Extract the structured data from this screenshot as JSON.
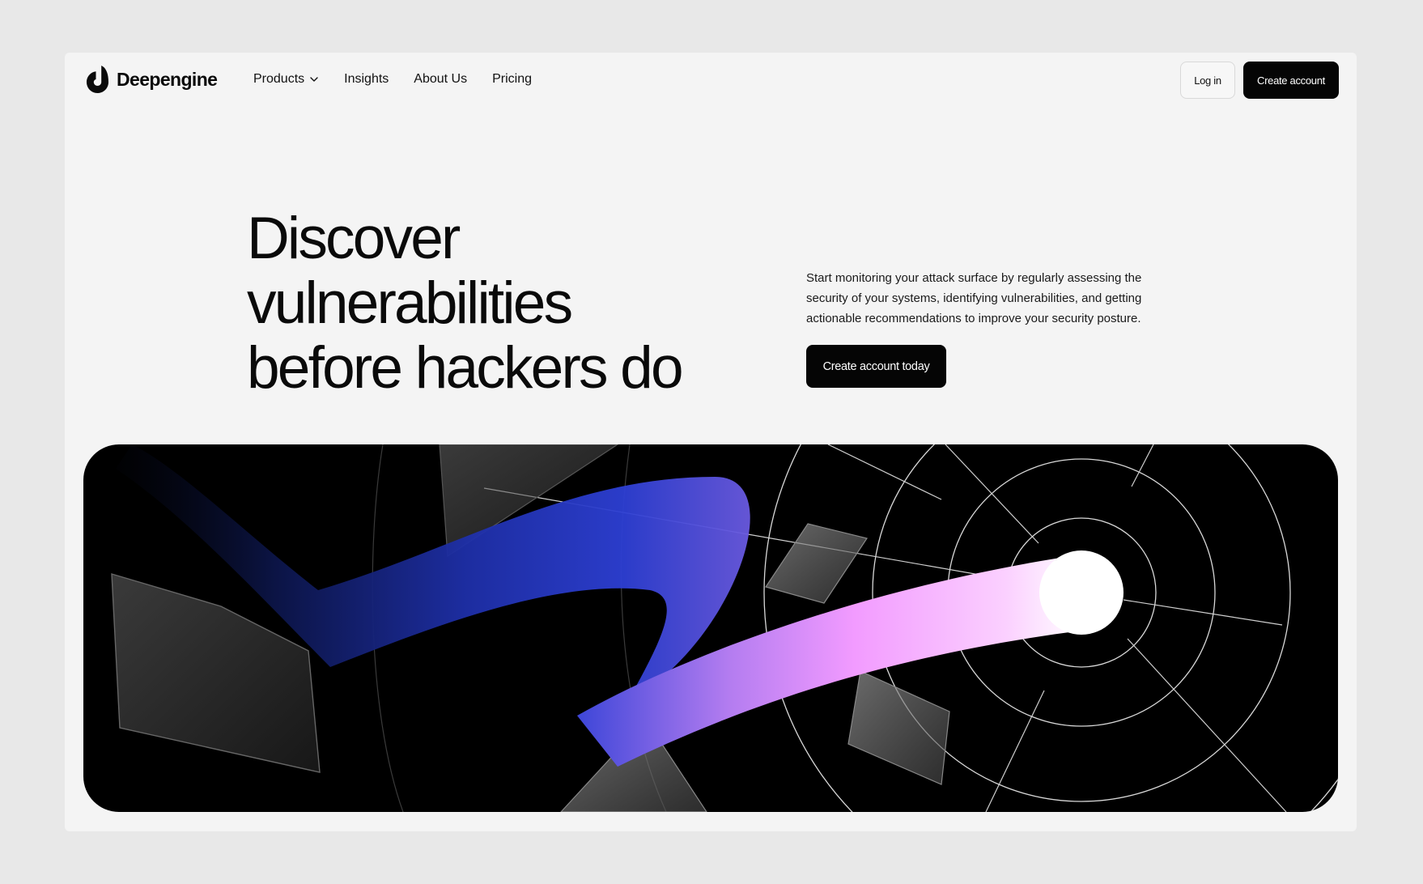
{
  "brand": {
    "name": "Deepengine",
    "logo_icon": "deepengine-logo-icon"
  },
  "nav": {
    "items": [
      {
        "label": "Products",
        "has_dropdown": true
      },
      {
        "label": "Insights"
      },
      {
        "label": "About Us"
      },
      {
        "label": "Pricing"
      }
    ],
    "login_label": "Log in",
    "create_account_label": "Create account"
  },
  "hero": {
    "headline_lines": [
      "Discover",
      "vulnerabilities",
      "before hackers do"
    ],
    "description": "Start monitoring your attack surface by regularly assessing the security of your systems, identifying vulnerabilities, and getting actionable recommendations to improve your security posture.",
    "cta_label": "Create account today"
  },
  "colors": {
    "page_bg": "#e8e8e8",
    "frame_bg": "#f4f4f4",
    "primary_button": "#050505",
    "art_bg": "#000000",
    "ribbon_blue": "#2b3fd6",
    "ribbon_pink": "#f7a8ff"
  }
}
